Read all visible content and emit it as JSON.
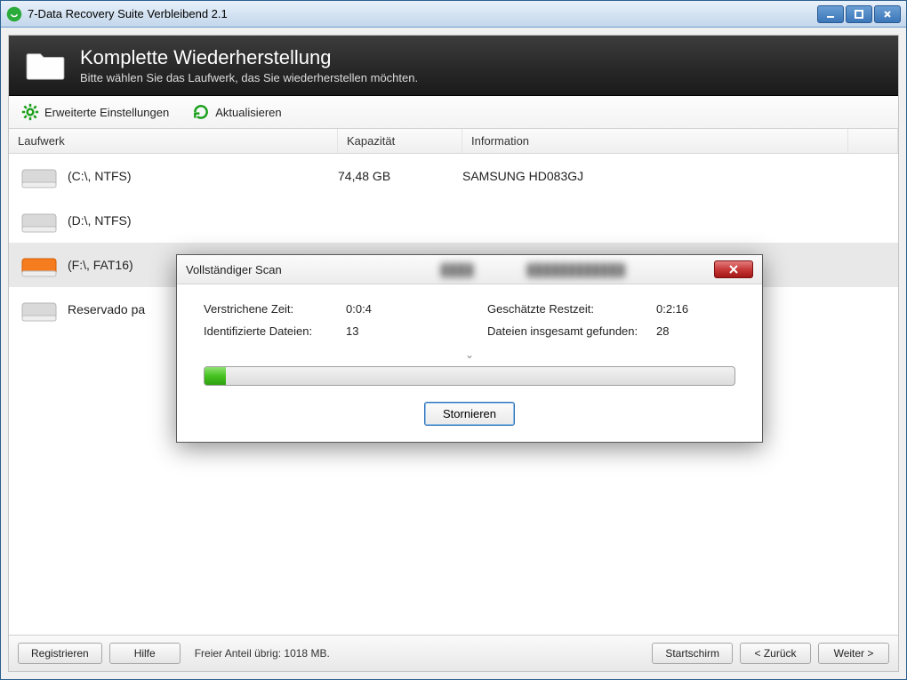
{
  "window": {
    "title": "7-Data Recovery Suite Verbleibend 2.1"
  },
  "hero": {
    "title": "Komplette Wiederherstellung",
    "subtitle": "Bitte wählen Sie das Laufwerk, das Sie wiederherstellen möchten."
  },
  "toolbar": {
    "advanced": "Erweiterte Einstellungen",
    "refresh": "Aktualisieren"
  },
  "columns": {
    "drive": "Laufwerk",
    "capacity": "Kapazität",
    "info": "Information"
  },
  "rows": [
    {
      "label": "(C:\\, NTFS)",
      "capacity": "74,48 GB",
      "info": "SAMSUNG HD083GJ",
      "selected": false,
      "highlight": false
    },
    {
      "label": "(D:\\, NTFS)",
      "capacity": "",
      "info": "",
      "selected": false,
      "highlight": false
    },
    {
      "label": "(F:\\, FAT16)",
      "capacity": "",
      "info": "",
      "selected": true,
      "highlight": true
    },
    {
      "label": "Reservado pa",
      "capacity": "",
      "info": "",
      "selected": false,
      "highlight": false
    }
  ],
  "bottom": {
    "register": "Registrieren",
    "help": "Hilfe",
    "status": "Freier Anteil übrig: 1018 MB.",
    "home": "Startschirm",
    "back": "< Zurück",
    "next": "Weiter >"
  },
  "modal": {
    "title": "Vollständiger Scan",
    "elapsed_label": "Verstrichene Zeit:",
    "elapsed_value": "0:0:4",
    "identified_label": "Identifizierte Dateien:",
    "identified_value": "13",
    "remaining_label": "Geschätzte Restzeit:",
    "remaining_value": "0:2:16",
    "total_label": "Dateien insgesamt gefunden:",
    "total_value": "28",
    "cancel": "Stornieren",
    "progress_percent": 4
  }
}
